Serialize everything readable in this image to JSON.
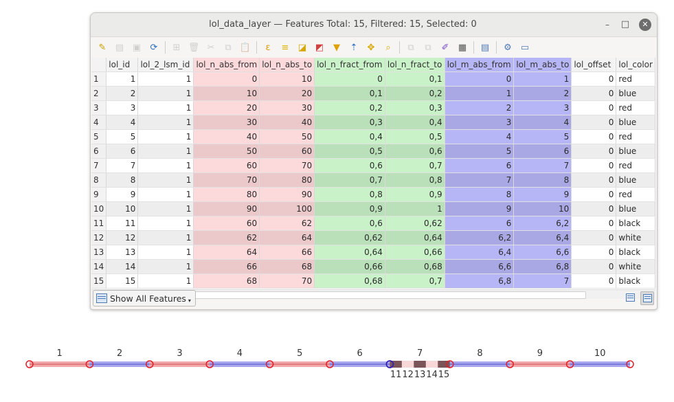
{
  "window": {
    "title": "lol_data_layer — Features Total: 15, Filtered: 15, Selected: 0",
    "min_label": "–",
    "max_label": "□",
    "close_label": "✕"
  },
  "toolbar": {
    "buttons": [
      {
        "name": "toggle-editing-icon",
        "glyph": "✎",
        "color": "#c8a000",
        "enabled": true
      },
      {
        "name": "multi-edit-icon",
        "glyph": "▤",
        "color": "#8a8a8a",
        "enabled": false
      },
      {
        "name": "save-edits-icon",
        "glyph": "▣",
        "color": "#8a8a8a",
        "enabled": false
      },
      {
        "name": "reload-icon",
        "glyph": "⟳",
        "color": "#2c6fbd",
        "enabled": true
      },
      {
        "name": "sep"
      },
      {
        "name": "add-feature-icon",
        "glyph": "⊞",
        "color": "#8a8a8a",
        "enabled": false
      },
      {
        "name": "delete-feature-icon",
        "glyph": "🗑",
        "color": "#8a8a8a",
        "enabled": false
      },
      {
        "name": "cut-icon",
        "glyph": "✂",
        "color": "#8a8a8a",
        "enabled": false
      },
      {
        "name": "copy-icon",
        "glyph": "⧉",
        "color": "#8a8a8a",
        "enabled": false
      },
      {
        "name": "paste-icon",
        "glyph": "📋",
        "color": "#8a8a8a",
        "enabled": false
      },
      {
        "name": "sep"
      },
      {
        "name": "select-by-expression-icon",
        "glyph": "ε",
        "color": "#d89a00",
        "enabled": true
      },
      {
        "name": "select-all-icon",
        "glyph": "≡",
        "color": "#e0b400",
        "enabled": true
      },
      {
        "name": "invert-selection-icon",
        "glyph": "◪",
        "color": "#d8a800",
        "enabled": true
      },
      {
        "name": "deselect-all-icon",
        "glyph": "◩",
        "color": "#d04040",
        "enabled": true
      },
      {
        "name": "filter-icon",
        "glyph": "▼",
        "color": "#e0a000",
        "enabled": true
      },
      {
        "name": "move-selection-top-icon",
        "glyph": "⇡",
        "color": "#2c6fbd",
        "enabled": true
      },
      {
        "name": "pan-to-selection-icon",
        "glyph": "✥",
        "color": "#d8a800",
        "enabled": true
      },
      {
        "name": "zoom-to-selection-icon",
        "glyph": "⌕",
        "color": "#d8a800",
        "enabled": true
      },
      {
        "name": "sep"
      },
      {
        "name": "copy-rows-icon",
        "glyph": "⧉",
        "color": "#8a8a8a",
        "enabled": false
      },
      {
        "name": "paste-rows-icon",
        "glyph": "⧉",
        "color": "#8a8a8a",
        "enabled": false
      },
      {
        "name": "new-field-icon",
        "glyph": "✐",
        "color": "#7a4cc0",
        "enabled": true
      },
      {
        "name": "field-calculator-icon",
        "glyph": "▦",
        "color": "#555555",
        "enabled": true
      },
      {
        "name": "sep"
      },
      {
        "name": "conditional-formatting-icon",
        "glyph": "▤",
        "color": "#4f7ab4",
        "enabled": true
      },
      {
        "name": "sep"
      },
      {
        "name": "actions-icon",
        "glyph": "⚙",
        "color": "#4f7ab4",
        "enabled": true
      },
      {
        "name": "dock-icon",
        "glyph": "▭",
        "color": "#4f7ab4",
        "enabled": true
      }
    ]
  },
  "table": {
    "columns": [
      {
        "label": "lol_id",
        "width": 50,
        "color": "",
        "align": "right"
      },
      {
        "label": "lol_2_lsm_id",
        "width": 82,
        "color": "",
        "align": "right"
      },
      {
        "label": "lol_n_abs_from",
        "width": 95,
        "color": "red",
        "align": "right"
      },
      {
        "label": "lol_n_abs_to",
        "width": 79,
        "color": "red",
        "align": "right"
      },
      {
        "label": "lol_n_fract_from",
        "width": 103,
        "color": "green",
        "align": "right"
      },
      {
        "label": "lol_n_fract_to",
        "width": 87,
        "color": "green",
        "align": "right"
      },
      {
        "label": "lol_m_abs_from",
        "width": 101,
        "color": "blue",
        "align": "right"
      },
      {
        "label": "lol_m_abs_to",
        "width": 84,
        "color": "blue",
        "align": "right"
      },
      {
        "label": "lol_offset",
        "width": 67,
        "color": "",
        "align": "right"
      },
      {
        "label": "lol_color",
        "width": 55,
        "color": "",
        "align": "left"
      }
    ],
    "rows": [
      [
        "1",
        "1",
        "1",
        "0",
        "10",
        "0",
        "0,1",
        "0",
        "1",
        "0",
        "red"
      ],
      [
        "2",
        "2",
        "1",
        "10",
        "20",
        "0,1",
        "0,2",
        "1",
        "2",
        "0",
        "blue"
      ],
      [
        "3",
        "3",
        "1",
        "20",
        "30",
        "0,2",
        "0,3",
        "2",
        "3",
        "0",
        "red"
      ],
      [
        "4",
        "4",
        "1",
        "30",
        "40",
        "0,3",
        "0,4",
        "3",
        "4",
        "0",
        "blue"
      ],
      [
        "5",
        "5",
        "1",
        "40",
        "50",
        "0,4",
        "0,5",
        "4",
        "5",
        "0",
        "red"
      ],
      [
        "6",
        "6",
        "1",
        "50",
        "60",
        "0,5",
        "0,6",
        "5",
        "6",
        "0",
        "blue"
      ],
      [
        "7",
        "7",
        "1",
        "60",
        "70",
        "0,6",
        "0,7",
        "6",
        "7",
        "0",
        "red"
      ],
      [
        "8",
        "8",
        "1",
        "70",
        "80",
        "0,7",
        "0,8",
        "7",
        "8",
        "0",
        "blue"
      ],
      [
        "9",
        "9",
        "1",
        "80",
        "90",
        "0,8",
        "0,9",
        "8",
        "9",
        "0",
        "red"
      ],
      [
        "10",
        "10",
        "1",
        "90",
        "100",
        "0,9",
        "1",
        "9",
        "10",
        "0",
        "blue"
      ],
      [
        "11",
        "11",
        "1",
        "60",
        "62",
        "0,6",
        "0,62",
        "6",
        "6,2",
        "0",
        "black"
      ],
      [
        "12",
        "12",
        "1",
        "62",
        "64",
        "0,62",
        "0,64",
        "6,2",
        "6,4",
        "0",
        "white"
      ],
      [
        "13",
        "13",
        "1",
        "64",
        "66",
        "0,64",
        "0,66",
        "6,4",
        "6,6",
        "0",
        "black"
      ],
      [
        "14",
        "14",
        "1",
        "66",
        "68",
        "0,66",
        "0,68",
        "6,6",
        "6,8",
        "0",
        "white"
      ],
      [
        "15",
        "15",
        "1",
        "68",
        "70",
        "0,68",
        "0,7",
        "6,8",
        "7",
        "0",
        "black"
      ]
    ]
  },
  "bottom": {
    "show_features_label": "Show All Features"
  },
  "strip": {
    "range": [
      0,
      100
    ],
    "segments": [
      {
        "label": "1",
        "from": 0,
        "to": 10,
        "color": "red"
      },
      {
        "label": "2",
        "from": 10,
        "to": 20,
        "color": "blue"
      },
      {
        "label": "3",
        "from": 20,
        "to": 30,
        "color": "red"
      },
      {
        "label": "4",
        "from": 30,
        "to": 40,
        "color": "blue"
      },
      {
        "label": "5",
        "from": 40,
        "to": 50,
        "color": "red"
      },
      {
        "label": "6",
        "from": 50,
        "to": 60,
        "color": "blue"
      },
      {
        "label": "7",
        "from": 60,
        "to": 70,
        "color": "red"
      },
      {
        "label": "8",
        "from": 70,
        "to": 80,
        "color": "blue"
      },
      {
        "label": "9",
        "from": 80,
        "to": 90,
        "color": "red"
      },
      {
        "label": "10",
        "from": 90,
        "to": 100,
        "color": "blue"
      }
    ],
    "sub_segments": [
      {
        "label": "11",
        "from": 60,
        "to": 62,
        "color": "black"
      },
      {
        "label": "12",
        "from": 62,
        "to": 64,
        "color": "white"
      },
      {
        "label": "13",
        "from": 64,
        "to": 66,
        "color": "black"
      },
      {
        "label": "14",
        "from": 66,
        "to": 68,
        "color": "white"
      },
      {
        "label": "15",
        "from": 68,
        "to": 70,
        "color": "black"
      }
    ],
    "colors": {
      "red": "#f2a7a9",
      "blue": "#a7a6ee",
      "black": "#7a5458",
      "white": "#f8d7d8",
      "node_red": "#e0202a",
      "node_blue": "#2020c0"
    }
  }
}
